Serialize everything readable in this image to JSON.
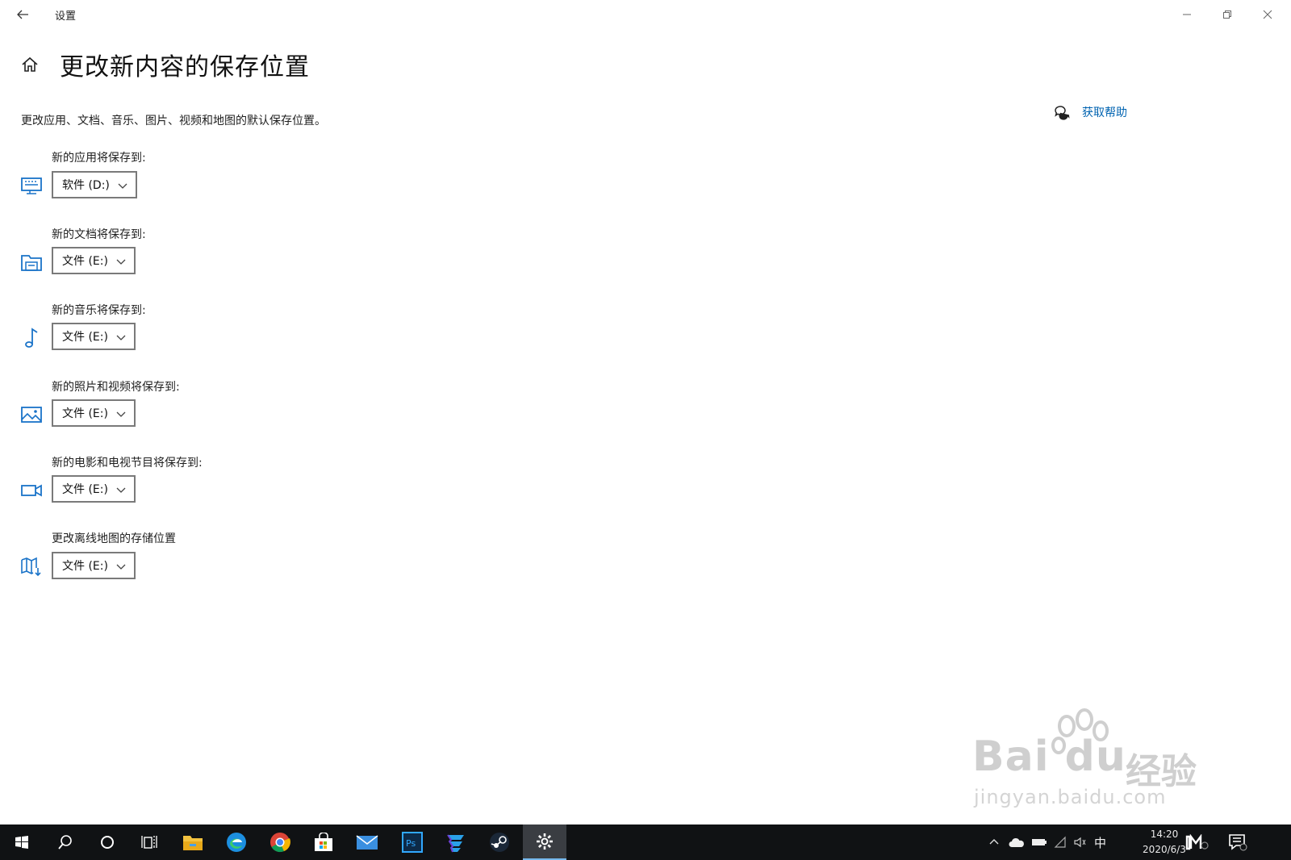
{
  "window": {
    "app_title": "设置",
    "back_icon": "back-arrow-icon",
    "controls": [
      "minimize-icon",
      "maximize-icon",
      "close-icon"
    ]
  },
  "header": {
    "title": "更改新内容的保存位置",
    "description": "更改应用、文档、音乐、图片、视频和地图的默认保存位置。",
    "help_label": "获取帮助"
  },
  "rows": [
    {
      "label": "新的应用将保存到:",
      "value": "软件 (D:)",
      "icon": "monitor-icon"
    },
    {
      "label": "新的文档将保存到:",
      "value": "文件 (E:)",
      "icon": "document-folder-icon"
    },
    {
      "label": "新的音乐将保存到:",
      "value": "文件 (E:)",
      "icon": "music-note-icon"
    },
    {
      "label": "新的照片和视频将保存到:",
      "value": "文件 (E:)",
      "icon": "picture-icon"
    },
    {
      "label": "新的电影和电视节目将保存到:",
      "value": "文件 (E:)",
      "icon": "video-camera-icon"
    },
    {
      "label": "更改离线地图的存储位置",
      "value": "文件 (E:)",
      "icon": "map-icon"
    }
  ],
  "watermark": {
    "brand": "Bai du",
    "brand_cn": "经验",
    "url": "jingyan.baidu.com"
  },
  "taskbar": {
    "apps": [
      "start-icon",
      "search-icon",
      "cortana-icon",
      "task-view-icon",
      "file-explorer-icon",
      "edge-icon",
      "chrome-icon",
      "store-icon",
      "mail-icon",
      "photoshop-icon",
      "app-icon",
      "steam-icon",
      "settings-icon"
    ],
    "input_method": "中",
    "time": "14:20",
    "date": "2020/6/3"
  },
  "colors": {
    "accent": "#0063b1",
    "icon_blue": "#1a73c8",
    "taskbar": "#101214"
  }
}
